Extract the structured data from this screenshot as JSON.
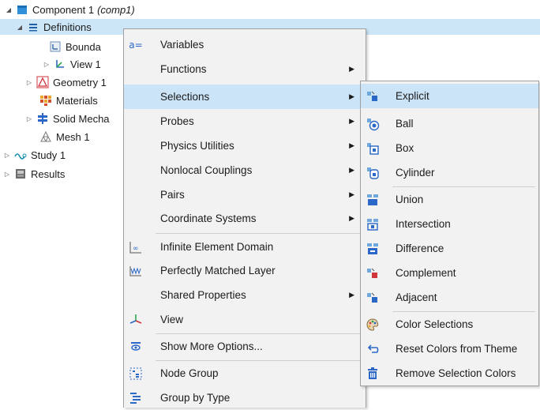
{
  "tree": {
    "component": {
      "label": "Component 1",
      "tag": "(comp1)"
    },
    "definitions": {
      "label": "Definitions"
    },
    "boundary": {
      "label": "Bounda"
    },
    "view": {
      "label": "View 1"
    },
    "geometry": {
      "label": "Geometry 1"
    },
    "materials": {
      "label": "Materials"
    },
    "solid": {
      "label": "Solid Mecha"
    },
    "mesh": {
      "label": "Mesh 1"
    },
    "study": {
      "label": "Study 1"
    },
    "results": {
      "label": "Results"
    }
  },
  "context_menu": {
    "items": [
      {
        "label": "Variables",
        "icon": "variables-icon"
      },
      {
        "label": "Functions",
        "submenu": true
      },
      {
        "label": "Selections",
        "submenu": true,
        "highlighted": true
      },
      {
        "label": "Probes",
        "submenu": true
      },
      {
        "label": "Physics Utilities",
        "submenu": true
      },
      {
        "label": "Nonlocal Couplings",
        "submenu": true
      },
      {
        "label": "Pairs",
        "submenu": true
      },
      {
        "label": "Coordinate Systems",
        "submenu": true
      },
      {
        "label": "Infinite Element Domain",
        "icon": "infinite-element-icon"
      },
      {
        "label": "Perfectly Matched Layer",
        "icon": "pml-icon"
      },
      {
        "label": "Shared Properties",
        "submenu": true
      },
      {
        "label": "View",
        "icon": "view-axes-icon"
      },
      {
        "label": "Show More Options...",
        "icon": "show-more-icon"
      },
      {
        "label": "Node Group",
        "icon": "node-group-icon"
      },
      {
        "label": "Group by Type",
        "icon": "group-by-type-icon"
      }
    ]
  },
  "selections_menu": {
    "items": [
      {
        "label": "Explicit",
        "highlighted": true
      },
      {
        "label": "Ball"
      },
      {
        "label": "Box"
      },
      {
        "label": "Cylinder"
      },
      {
        "label": "Union"
      },
      {
        "label": "Intersection"
      },
      {
        "label": "Difference"
      },
      {
        "label": "Complement"
      },
      {
        "label": "Adjacent"
      },
      {
        "label": "Color Selections"
      },
      {
        "label": "Reset Colors from Theme"
      },
      {
        "label": "Remove Selection Colors"
      }
    ]
  },
  "colors": {
    "highlight": "#cce4f7",
    "accent": "#1e73c8",
    "menu_bg": "#f2f2f2"
  }
}
